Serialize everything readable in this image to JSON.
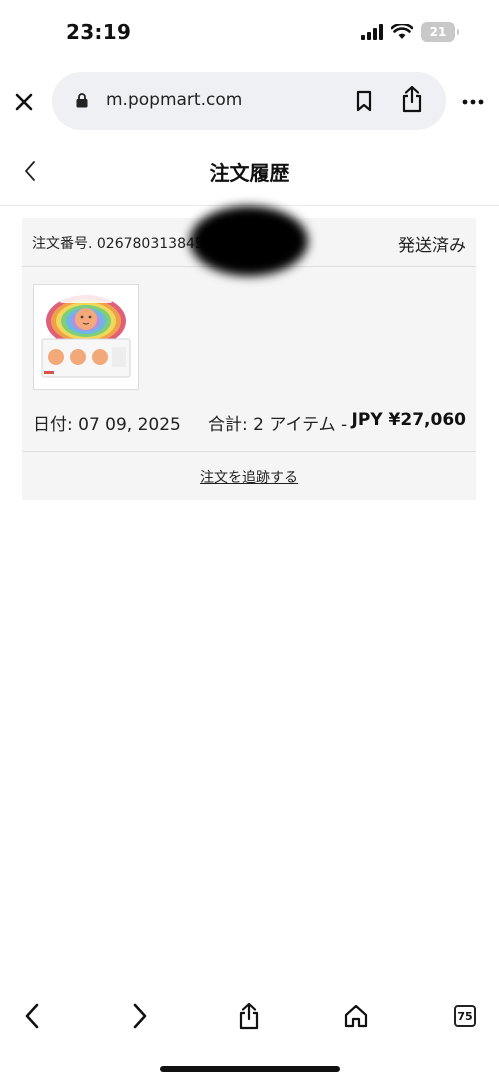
{
  "status_bar": {
    "time": "23:19",
    "battery": "21",
    "signal_icon": "cellular-signal-icon",
    "wifi_icon": "wifi-icon"
  },
  "browser": {
    "url": "m.popmart.com",
    "close_icon": "close-icon",
    "lock_icon": "lock-icon",
    "bookmark_icon": "bookmark-icon",
    "share_icon": "share-icon",
    "more_icon": "more-icon"
  },
  "page": {
    "title": "注文履歴",
    "back_icon": "chevron-left-icon"
  },
  "order": {
    "number_label": "注文番号. 026780313845",
    "status": "発送済み",
    "date_label": "日付: 07 09, 2025",
    "total_label": "合計: 2 アイテム  -",
    "total_price": "JPY ¥27,060",
    "track_link": "注文を追跡する",
    "thumbnail_icon": "product-box-image"
  },
  "toolbar": {
    "back_icon": "chevron-left-icon",
    "forward_icon": "chevron-right-icon",
    "share_icon": "share-icon",
    "home_icon": "home-icon",
    "tabs_count": "75"
  },
  "colors": {
    "card_bg": "#f5f5f5",
    "url_pill_bg": "#eef0f3",
    "battery_bg": "#c8c8c8"
  }
}
